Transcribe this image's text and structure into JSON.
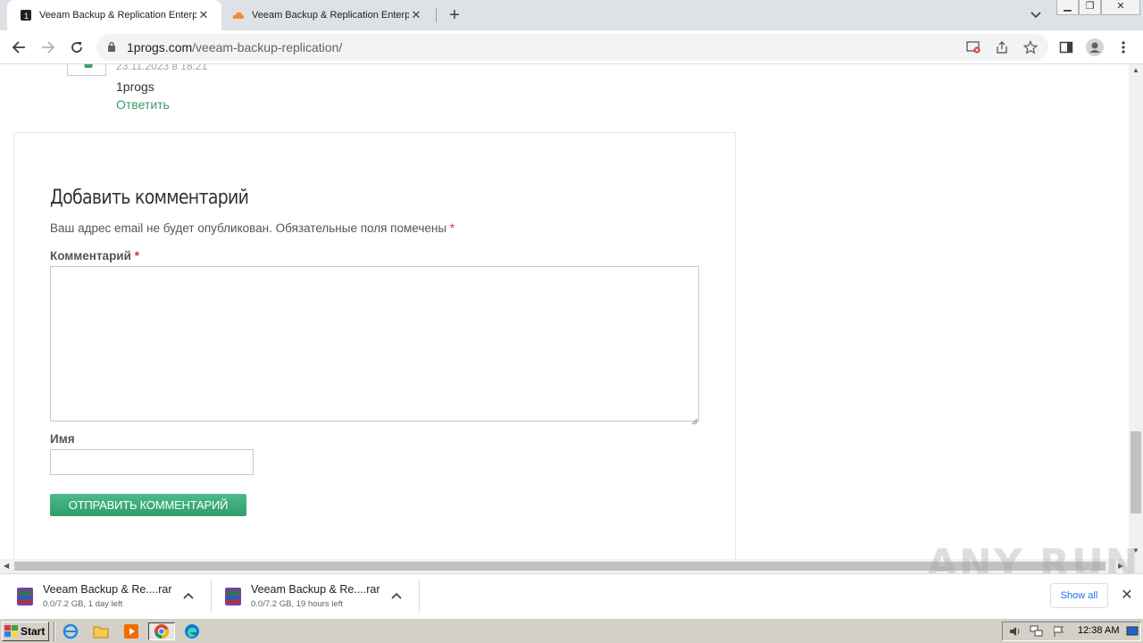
{
  "browser": {
    "tabs": [
      {
        "title": "Veeam Backup & Replication Enterpr",
        "active": true,
        "favicon": "numbered-1-icon"
      },
      {
        "title": "Veeam Backup & Replication Enterpr",
        "active": false,
        "favicon": "cloud-icon"
      }
    ],
    "new_tab": "+",
    "url_host": "1progs.com",
    "url_path": "/veeam-backup-replication/"
  },
  "comment": {
    "date": "23.11.2023 в 18:21",
    "author": "1progs",
    "reply": "Ответить"
  },
  "form": {
    "title": "Добавить комментарий",
    "notes": "Ваш адрес email не будет опубликован. Обязательные поля помечены",
    "required_mark": "*",
    "comment_label": "Комментарий",
    "comment_value": "",
    "name_label": "Имя",
    "name_value": "",
    "submit": "ОТПРАВИТЬ КОММЕНТАРИЙ"
  },
  "watermark": "ANY RUN",
  "downloads": [
    {
      "name": "Veeam Backup & Re....rar",
      "status": "0.0/7.2 GB, 1 day left"
    },
    {
      "name": "Veeam Backup & Re....rar",
      "status": "0.0/7.2 GB, 19 hours left"
    }
  ],
  "shelf": {
    "show_all": "Show all"
  },
  "taskbar": {
    "start": "Start",
    "clock": "12:38 AM"
  },
  "colors": {
    "accent_green": "#3a9a68",
    "button_green": "#3fae7a",
    "required_red": "#dd3333"
  }
}
